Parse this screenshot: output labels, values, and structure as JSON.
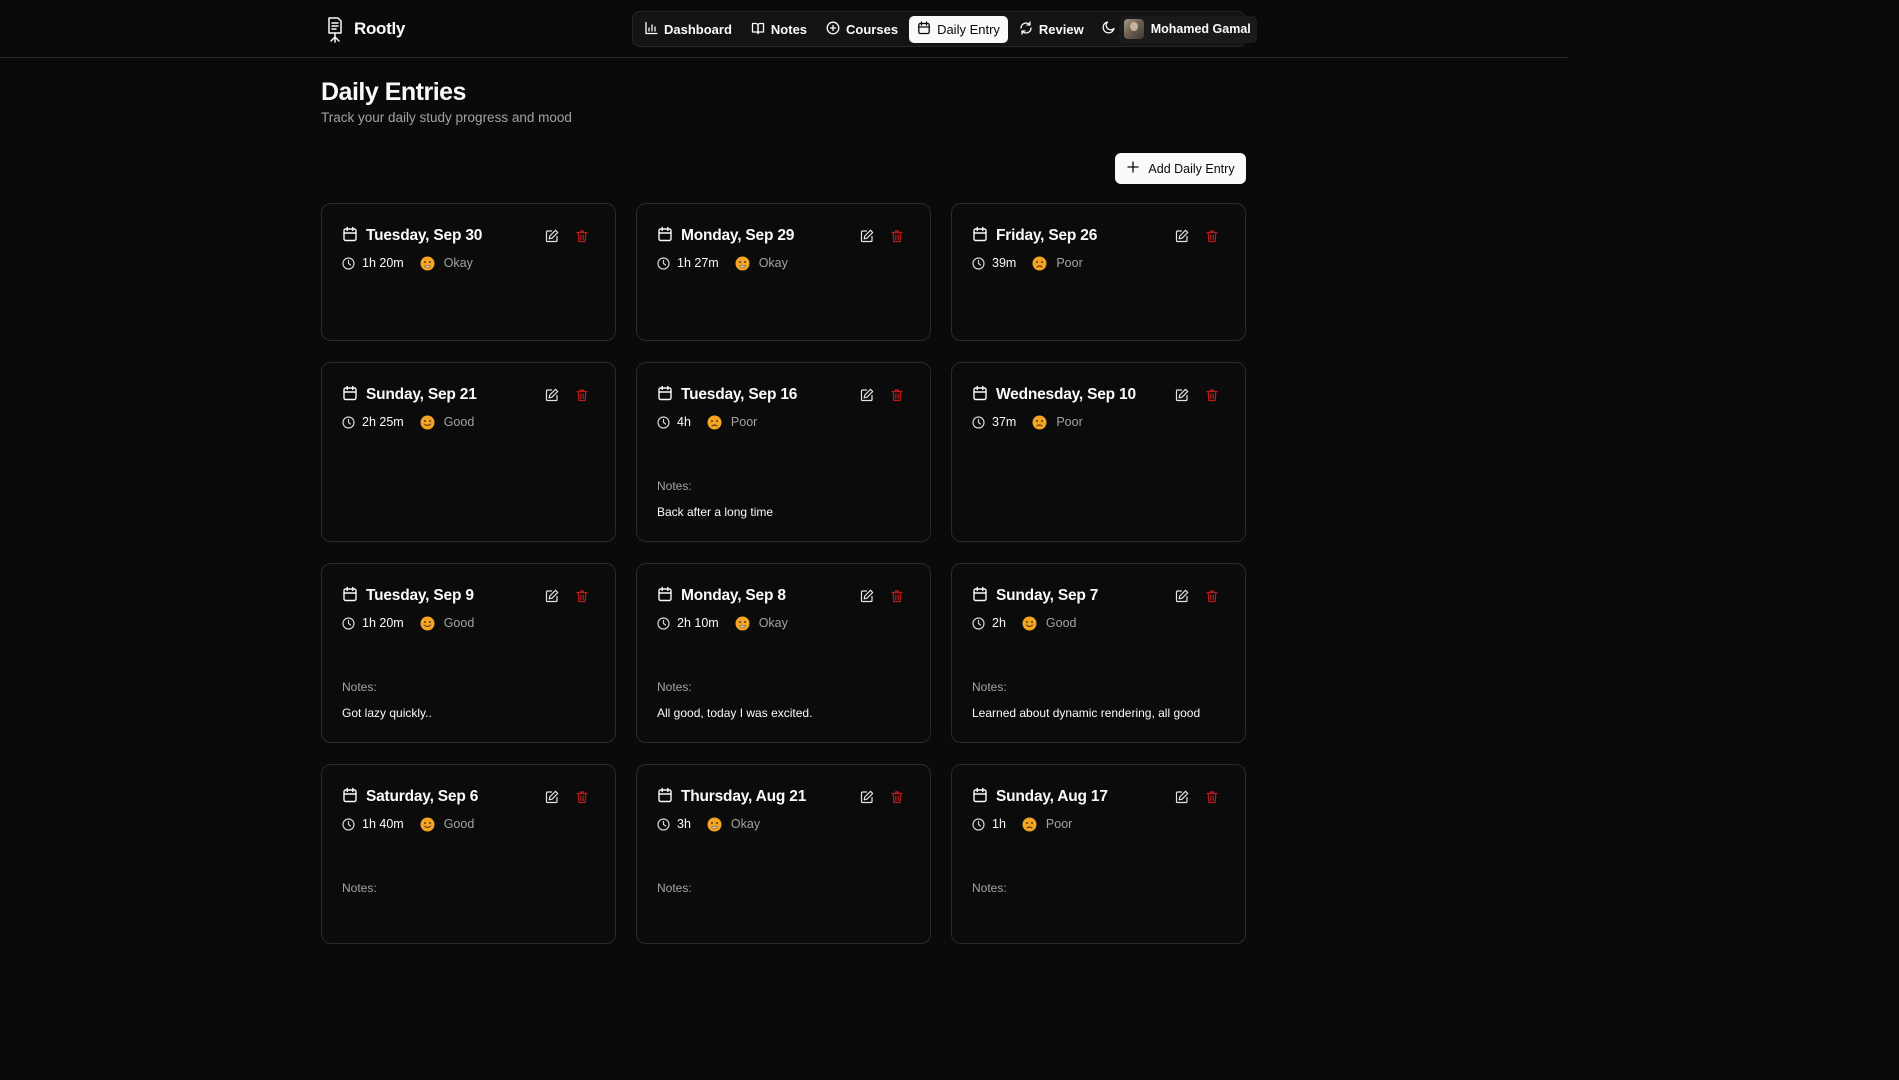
{
  "app": {
    "name": "Rootly"
  },
  "nav": {
    "items": [
      {
        "label": "Dashboard",
        "icon": "bar-chart-icon",
        "active": false
      },
      {
        "label": "Notes",
        "icon": "book-open-icon",
        "active": false
      },
      {
        "label": "Courses",
        "icon": "plus-circle-icon",
        "active": false
      },
      {
        "label": "Daily Entry",
        "icon": "calendar-icon",
        "active": true
      },
      {
        "label": "Review",
        "icon": "refresh-icon",
        "active": false
      }
    ],
    "theme_icon": "moon-icon",
    "user_name": "Mohamed Gamal"
  },
  "page": {
    "title": "Daily Entries",
    "subtitle": "Track your daily study progress and mood",
    "add_button_label": "Add Daily Entry"
  },
  "entries": [
    {
      "date": "Tuesday, Sep 30",
      "duration": "1h 20m",
      "mood": "Okay",
      "notes_label": "",
      "notes": ""
    },
    {
      "date": "Monday, Sep 29",
      "duration": "1h 27m",
      "mood": "Okay",
      "notes_label": "",
      "notes": ""
    },
    {
      "date": "Friday, Sep 26",
      "duration": "39m",
      "mood": "Poor",
      "notes_label": "",
      "notes": ""
    },
    {
      "date": "Sunday, Sep 21",
      "duration": "2h 25m",
      "mood": "Good",
      "notes_label": "",
      "notes": ""
    },
    {
      "date": "Tuesday, Sep 16",
      "duration": "4h",
      "mood": "Poor",
      "notes_label": "Notes:",
      "notes": "Back after a long time"
    },
    {
      "date": "Wednesday, Sep 10",
      "duration": "37m",
      "mood": "Poor",
      "notes_label": "",
      "notes": ""
    },
    {
      "date": "Tuesday, Sep 9",
      "duration": "1h 20m",
      "mood": "Good",
      "notes_label": "Notes:",
      "notes": "Got lazy quickly.."
    },
    {
      "date": "Monday, Sep 8",
      "duration": "2h 10m",
      "mood": "Okay",
      "notes_label": "Notes:",
      "notes": "All good, today I was excited."
    },
    {
      "date": "Sunday, Sep 7",
      "duration": "2h",
      "mood": "Good",
      "notes_label": "Notes:",
      "notes": "Learned about dynamic rendering, all good"
    },
    {
      "date": "Saturday, Sep 6",
      "duration": "1h 40m",
      "mood": "Good",
      "notes_label": "Notes:",
      "notes": ""
    },
    {
      "date": "Thursday, Aug 21",
      "duration": "3h",
      "mood": "Okay",
      "notes_label": "Notes:",
      "notes": ""
    },
    {
      "date": "Sunday, Aug 17",
      "duration": "1h",
      "mood": "Poor",
      "notes_label": "Notes:",
      "notes": ""
    }
  ],
  "colors": {
    "background": "#0a0a0a",
    "card_border": "#2a2a2a",
    "delete_red": "#b91c1c",
    "emoji_yellow": "#f5a524"
  }
}
